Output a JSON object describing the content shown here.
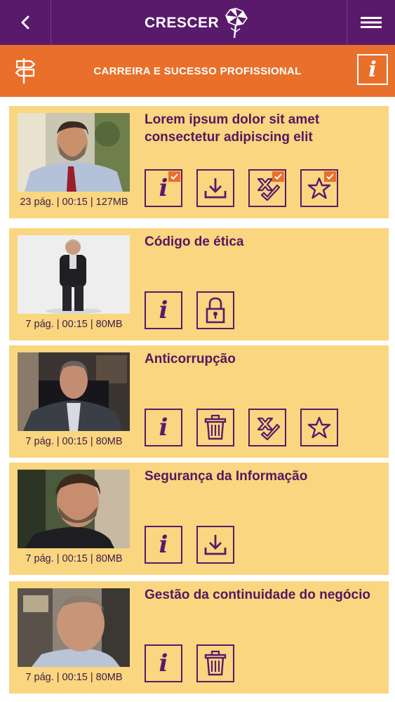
{
  "header": {
    "brand": "CRESCER",
    "back_icon": "chevron-left-icon",
    "menu_icon": "hamburger-menu-icon",
    "colors": {
      "purple": "#591a6b",
      "orange": "#e9702a",
      "card": "#f9d67f"
    }
  },
  "category": {
    "title": "CARREIRA E SUCESSO PROFISSIONAL",
    "icon": "signpost-icon",
    "info_label": "i"
  },
  "items": [
    {
      "title": "Lorem ipsum dolor sit amet consectetur adipiscing elit",
      "meta": "23 pág. | 00:15 | 127MB",
      "actions": [
        "info",
        "download",
        "quiz",
        "favorite"
      ],
      "checked": [
        "info",
        "quiz",
        "favorite"
      ]
    },
    {
      "title": "Código de ética",
      "meta": "7 pág. | 00:15 | 80MB",
      "actions": [
        "info",
        "locked"
      ]
    },
    {
      "title": "Anticorrupção",
      "meta": "7 pág. | 00:15 | 80MB",
      "actions": [
        "info",
        "delete",
        "quiz",
        "favorite"
      ]
    },
    {
      "title": "Segurança da Informação",
      "meta": "7 pág. | 00:15 | 80MB",
      "actions": [
        "info",
        "download"
      ]
    },
    {
      "title": "Gestão da continuidade do negócio",
      "meta": "7 pág. | 00:15 | 80MB",
      "actions": [
        "info",
        "delete"
      ]
    }
  ]
}
